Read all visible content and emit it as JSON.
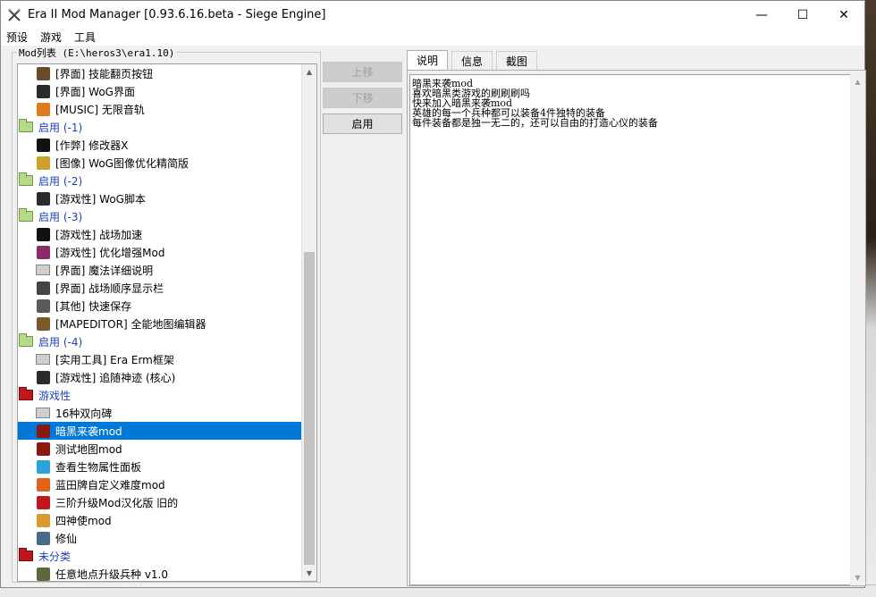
{
  "window": {
    "title": "Era II Mod Manager [0.93.6.16.beta - Siege Engine]",
    "controls": {
      "minimize": "—",
      "maximize": "☐",
      "close": "✕"
    }
  },
  "menu": [
    "预设",
    "游戏",
    "工具"
  ],
  "mod_list": {
    "label": "Mod列表 (E:\\heros3\\era1.10)",
    "rows": [
      {
        "kind": "item",
        "icon": "skill-icon",
        "color": "#6b4a2a",
        "text": "[界面] 技能翻页按钮"
      },
      {
        "kind": "item",
        "icon": "wog-icon",
        "color": "#2b2b2b",
        "text": "[界面] WoG界面"
      },
      {
        "kind": "item",
        "icon": "music-icon",
        "color": "#e07a1c",
        "text": "[MUSIC] 无限音轨"
      },
      {
        "kind": "group",
        "folder": "green",
        "text": "启用 (-1)"
      },
      {
        "kind": "item",
        "icon": "skull-icon",
        "color": "#111111",
        "text": "[作弊] 修改器X"
      },
      {
        "kind": "item",
        "icon": "image-icon",
        "color": "#c9a12b",
        "text": "[图像] WoG图像优化精简版"
      },
      {
        "kind": "group",
        "folder": "green",
        "text": "启用 (-2)"
      },
      {
        "kind": "item",
        "icon": "wog-icon",
        "color": "#2b2b2b",
        "text": "[游戏性] WoG脚本"
      },
      {
        "kind": "group",
        "folder": "green",
        "text": "启用 (-3)"
      },
      {
        "kind": "item",
        "icon": "run-icon",
        "color": "#111111",
        "text": "[游戏性] 战场加速"
      },
      {
        "kind": "item",
        "icon": "enhance-icon",
        "color": "#8a2b6b",
        "text": "[游戏性] 优化增强Mod"
      },
      {
        "kind": "item",
        "icon": "folder-icon",
        "color": "#cfcfcf",
        "text": "[界面] 魔法详细说明"
      },
      {
        "kind": "item",
        "icon": "queue-icon",
        "color": "#444444",
        "text": "[界面] 战场顺序显示栏"
      },
      {
        "kind": "item",
        "icon": "save-icon",
        "color": "#5a5a5a",
        "text": "[其他] 快速保存"
      },
      {
        "kind": "item",
        "icon": "map-editor-icon",
        "color": "#7a5a2a",
        "text": "[MAPEDITOR] 全能地图编辑器"
      },
      {
        "kind": "group",
        "folder": "green",
        "text": "启用 (-4)"
      },
      {
        "kind": "item",
        "icon": "folder-icon",
        "color": "#cfcfcf",
        "text": "[实用工具] Era Erm框架"
      },
      {
        "kind": "item",
        "icon": "wog-icon",
        "color": "#2b2b2b",
        "text": "[游戏性] 追随神迹 (核心)"
      },
      {
        "kind": "group",
        "folder": "red",
        "text": "游戏性"
      },
      {
        "kind": "item",
        "icon": "folder-icon",
        "color": "#cfcfcf",
        "text": "16种双向碑"
      },
      {
        "kind": "item",
        "icon": "dark-icon",
        "color": "#8a1a10",
        "text": "暗黑来袭mod",
        "selected": true
      },
      {
        "kind": "item",
        "icon": "dark-icon",
        "color": "#8a1a10",
        "text": "测试地图mod"
      },
      {
        "kind": "item",
        "icon": "creature-icon",
        "color": "#2aa3d8",
        "text": "查看生物属性面板"
      },
      {
        "kind": "item",
        "icon": "difficulty-icon",
        "color": "#e0641c",
        "text": "蓝田牌自定义难度mod"
      },
      {
        "kind": "item",
        "icon": "upgrade-icon",
        "color": "#c0161c",
        "text": "三阶升级Mod汉化版 旧的"
      },
      {
        "kind": "item",
        "icon": "envoy-icon",
        "color": "#d89a2a",
        "text": "四神使mod"
      },
      {
        "kind": "item",
        "icon": "immortal-icon",
        "color": "#4a6a8a",
        "text": "修仙"
      },
      {
        "kind": "group",
        "folder": "red",
        "text": "未分类"
      },
      {
        "kind": "item",
        "icon": "upgrade-troops-icon",
        "color": "#5a6a3a",
        "text": "任意地点升级兵种 v1.0"
      }
    ]
  },
  "buttons": {
    "move_up": "上移",
    "move_down": "下移",
    "enable": "启用"
  },
  "tabs": [
    "说明",
    "信息",
    "截图"
  ],
  "description": [
    "暗黑来袭mod",
    "喜欢暗黑类游戏的刷刷刷吗",
    "快来加入暗黑来袭mod",
    "英雄的每一个兵种都可以装备4件独特的装备",
    "每件装备都是独一无二的，还可以自由的打造心仪的装备"
  ]
}
